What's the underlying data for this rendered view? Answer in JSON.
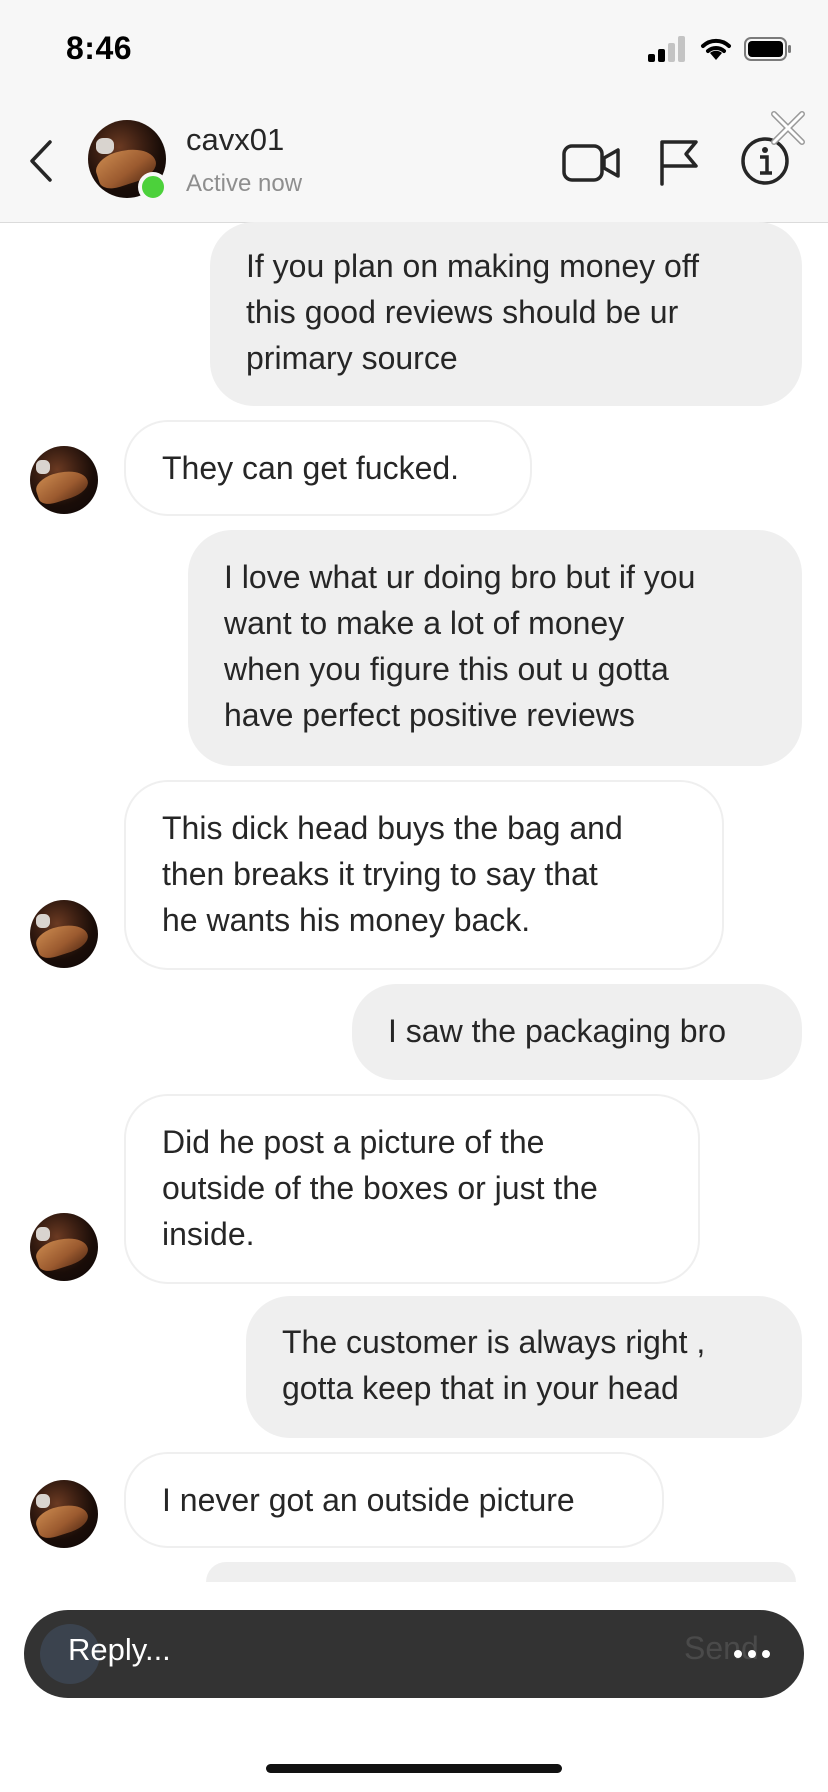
{
  "status_bar": {
    "time": "8:46"
  },
  "header": {
    "username": "cavx01",
    "status": "Active now",
    "icons": {
      "back": "chevron-left-icon",
      "video": "video-camera-icon",
      "flag": "flag-icon",
      "info": "info-icon",
      "close": "close-icon"
    }
  },
  "messages": [
    {
      "direction": "sent",
      "lines": [
        "If you plan on making money off",
        "this good reviews should be ur",
        "primary source"
      ]
    },
    {
      "direction": "received",
      "lines": [
        "They can get fucked."
      ]
    },
    {
      "direction": "sent",
      "lines": [
        "I love what ur doing bro but if you",
        "want to make a lot of money",
        "when you figure this out u gotta",
        "have perfect positive reviews"
      ]
    },
    {
      "direction": "received",
      "lines": [
        "This dick head buys the bag and",
        "then breaks it trying to say that",
        "he wants his money back."
      ]
    },
    {
      "direction": "sent",
      "lines": [
        "I saw the packaging bro"
      ]
    },
    {
      "direction": "received",
      "lines": [
        "Did he post a picture of the",
        "outside of the boxes or just the",
        "inside."
      ]
    },
    {
      "direction": "sent",
      "lines": [
        "The customer is always right ,",
        "gotta keep that in your head"
      ]
    },
    {
      "direction": "received",
      "lines": [
        "I never got an outside picture"
      ]
    }
  ],
  "composer": {
    "placeholder": "Reply...",
    "ghost_send": "Send",
    "more_icon": "more-horizontal-icon"
  },
  "colors": {
    "sent_bubble": "#efefef",
    "received_border": "#efefef",
    "active_dot": "#4cd13b",
    "reply_bar": "#333333"
  }
}
